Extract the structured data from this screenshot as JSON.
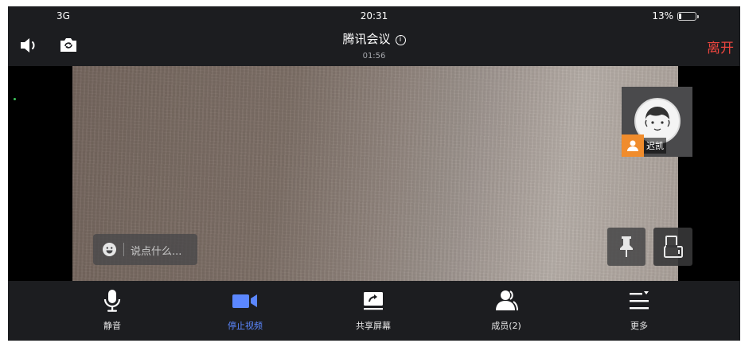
{
  "status_bar": {
    "network": "3G",
    "time": "20:31",
    "battery": "13%",
    "battery_level": 0.13
  },
  "header": {
    "title": "腾讯会议",
    "info_icon": "info-icon",
    "duration": "01:56",
    "leave_label": "离开",
    "leave_color": "#e9453e"
  },
  "chat": {
    "placeholder": "说点什么..."
  },
  "participant": {
    "name": "迟凯",
    "badge_color": "#f08c2c"
  },
  "toolbar": {
    "items": [
      {
        "label": "静音",
        "icon": "microphone-icon"
      },
      {
        "label": "停止视频",
        "icon": "video-camera-icon",
        "active": true,
        "color": "#5b87ff"
      },
      {
        "label": "共享屏幕",
        "icon": "share-screen-icon"
      },
      {
        "label": "成员(2)",
        "icon": "members-icon"
      },
      {
        "label": "更多",
        "icon": "more-menu-icon"
      }
    ]
  }
}
